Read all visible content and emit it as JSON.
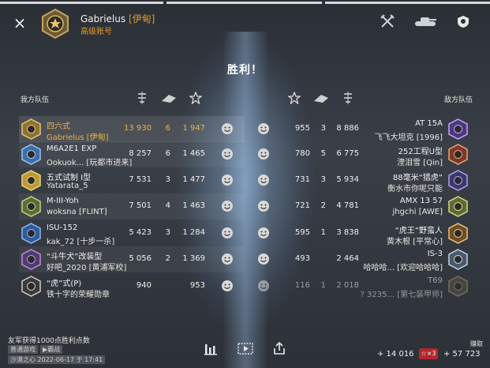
{
  "header": {
    "player_name": "Gabrielus",
    "player_clan": "[伊甸]",
    "account_type": "高级账号",
    "close_icon": "×"
  },
  "title": "胜利！",
  "my_team_label": "我方队伍",
  "enemy_team_label": "敌方队伍",
  "left_rows": [
    {
      "tank": "四六式",
      "player": "Gabrielus [伊甸]",
      "dmg": "13 930",
      "kills": "6",
      "xp": "1 947",
      "highlight": true
    },
    {
      "tank": "M6A2E1 EXP",
      "player": "Ookuok... [玩都市进来]",
      "dmg": "8 257",
      "kills": "6",
      "xp": "1 465"
    },
    {
      "tank": "五式试制 I型",
      "player": "Yatarata_5",
      "dmg": "7 531",
      "kills": "3",
      "xp": "1 477"
    },
    {
      "tank": "M-III-Yoh",
      "player": "woksna [FLINT]",
      "dmg": "7 501",
      "kills": "4",
      "xp": "1 463"
    },
    {
      "tank": "ISU-152",
      "player": "kak_72 [十步一杀]",
      "dmg": "5 423",
      "kills": "3",
      "xp": "1 284"
    },
    {
      "tank": "“斗牛犬”改装型",
      "player": "好吧_2020 [黄浦军校]",
      "dmg": "5 056",
      "kills": "2",
      "xp": "1 369"
    },
    {
      "tank": "“虎”式(P)",
      "player": "铁十字的荣耀勋章",
      "dmg": "940",
      "kills": "",
      "xp": "953"
    }
  ],
  "right_rows": [
    {
      "tank": "AT 15A",
      "player": "飞飞大坦克 [1996]",
      "xp": "955",
      "kills": "3",
      "dmg": "8 886"
    },
    {
      "tank": "252工程U型",
      "player": "湮泪雪 [Qin]",
      "xp": "780",
      "kills": "5",
      "dmg": "6 775"
    },
    {
      "tank": "88毫米“猎虎”",
      "player": "衡水市你呢只能",
      "xp": "731",
      "kills": "3",
      "dmg": "5 934"
    },
    {
      "tank": "AMX 13 57",
      "player": "jhgchi [AWE]",
      "xp": "721",
      "kills": "2",
      "dmg": "4 781"
    },
    {
      "tank": "“虎王”野蛮人",
      "player": "黄木根 [平常心]",
      "xp": "595",
      "kills": "1",
      "dmg": "3 838"
    },
    {
      "tank": "IS-3",
      "player": "哈哈哈... [欢迎哈哈哈]",
      "xp": "493",
      "kills": "",
      "dmg": "2 464"
    },
    {
      "tank": "T69",
      "player": "? 3235... [第七装甲师]",
      "xp": "116",
      "kills": "1",
      "dmg": "2 018",
      "dim": true
    }
  ],
  "footer": {
    "victory_points": "友军获得1000点胜利点数",
    "tag1": "普通游戏",
    "tag2": "▶霸战",
    "map_date": "沙漠之心  2022-06-17 于 17:41",
    "earned_label": "赚取",
    "xp_total": "+ 14 016",
    "multiplier": "☆×3",
    "credits_total": "+ 57 723"
  },
  "colors": {
    "accent_gold": "#e8b24a",
    "clan_orange": "#e39b2b",
    "multiplier_red": "#b3262e"
  }
}
